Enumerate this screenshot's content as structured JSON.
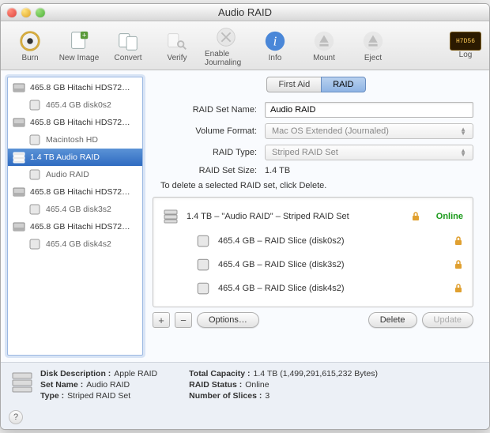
{
  "window": {
    "title": "Audio RAID"
  },
  "toolbar": {
    "items": [
      {
        "label": "Burn",
        "enabled": true,
        "icon": "burn"
      },
      {
        "label": "New Image",
        "enabled": true,
        "icon": "new-image"
      },
      {
        "label": "Convert",
        "enabled": true,
        "icon": "convert"
      },
      {
        "label": "Verify",
        "enabled": false,
        "icon": "verify"
      },
      {
        "label": "Enable Journaling",
        "enabled": false,
        "icon": "journal"
      },
      {
        "label": "Info",
        "enabled": true,
        "icon": "info"
      },
      {
        "label": "Mount",
        "enabled": false,
        "icon": "mount"
      },
      {
        "label": "Eject",
        "enabled": false,
        "icon": "eject"
      }
    ],
    "log_label": "Log",
    "log_screen": "H7D56"
  },
  "sidebar": {
    "items": [
      {
        "kind": "disk",
        "label": "465.8 GB Hitachi HDS72…"
      },
      {
        "kind": "vol",
        "label": "465.4 GB disk0s2"
      },
      {
        "kind": "disk",
        "label": "465.8 GB Hitachi HDS72…"
      },
      {
        "kind": "vol",
        "label": "Macintosh HD"
      },
      {
        "kind": "raid",
        "label": "1.4 TB Audio RAID",
        "selected": true
      },
      {
        "kind": "vol",
        "label": "Audio RAID"
      },
      {
        "kind": "disk",
        "label": "465.8 GB Hitachi HDS72…"
      },
      {
        "kind": "vol",
        "label": "465.4 GB disk3s2"
      },
      {
        "kind": "disk",
        "label": "465.8 GB Hitachi HDS72…"
      },
      {
        "kind": "vol",
        "label": "465.4 GB disk4s2"
      }
    ]
  },
  "tabs": {
    "first_aid": "First Aid",
    "raid": "RAID"
  },
  "form": {
    "name_label": "RAID Set Name:",
    "name_value": "Audio RAID",
    "format_label": "Volume Format:",
    "format_value": "Mac OS Extended (Journaled)",
    "type_label": "RAID Type:",
    "type_value": "Striped RAID Set",
    "size_label": "RAID Set Size:",
    "size_value": "1.4 TB",
    "delete_hint": "To delete a selected RAID set, click Delete."
  },
  "raidset": {
    "header": "1.4 TB – \"Audio RAID\" – Striped RAID Set",
    "status": "Online",
    "slices": [
      "465.4 GB – RAID Slice (disk0s2)",
      "465.4 GB – RAID Slice (disk3s2)",
      "465.4 GB – RAID Slice (disk4s2)"
    ]
  },
  "buttons": {
    "plus": "+",
    "minus": "−",
    "options": "Options…",
    "delete": "Delete",
    "update": "Update"
  },
  "footer": {
    "left": {
      "k1": "Disk Description :",
      "v1": "Apple RAID",
      "k2": "Set Name :",
      "v2": "Audio RAID",
      "k3": "Type :",
      "v3": "Striped RAID Set"
    },
    "right": {
      "k1": "Total Capacity :",
      "v1": "1.4 TB (1,499,291,615,232 Bytes)",
      "k2": "RAID Status :",
      "v2": "Online",
      "k3": "Number of Slices :",
      "v3": "3"
    },
    "help": "?"
  }
}
